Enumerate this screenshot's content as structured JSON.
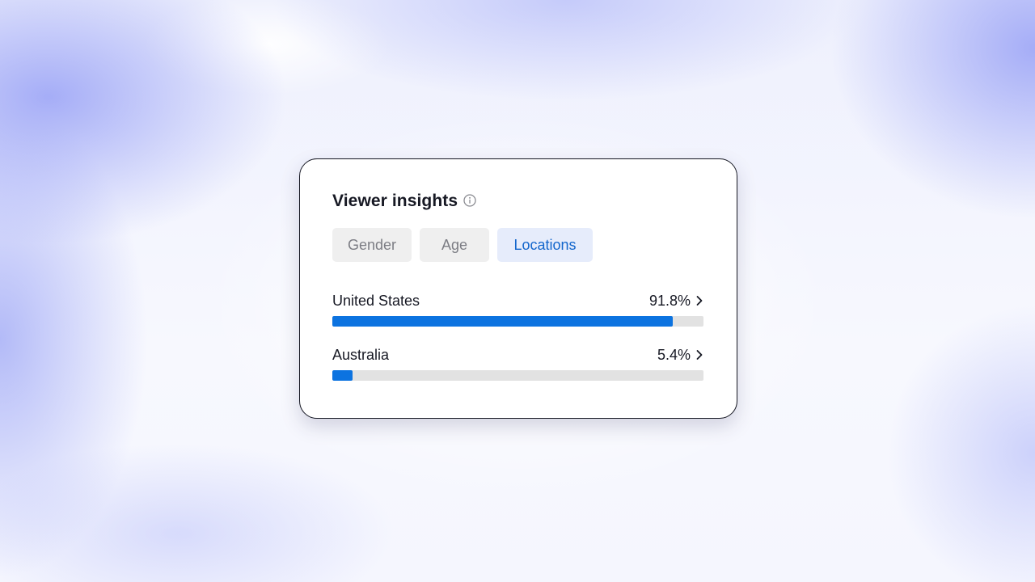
{
  "card": {
    "title": "Viewer insights",
    "info_icon": "info-circle-icon"
  },
  "tabs": [
    {
      "label": "Gender",
      "active": false
    },
    {
      "label": "Age",
      "active": false
    },
    {
      "label": "Locations",
      "active": true
    }
  ],
  "locations": [
    {
      "name": "United States",
      "percent_label": "91.8%",
      "percent": 91.8
    },
    {
      "name": "Australia",
      "percent_label": "5.4%",
      "percent": 5.4
    }
  ],
  "colors": {
    "accent": "#0c73e0",
    "active_tab_bg": "#e6ecfb",
    "active_tab_text": "#1366cc",
    "track": "#e2e2e2"
  },
  "icons": {
    "row_chevron": "chevron-right-icon"
  }
}
